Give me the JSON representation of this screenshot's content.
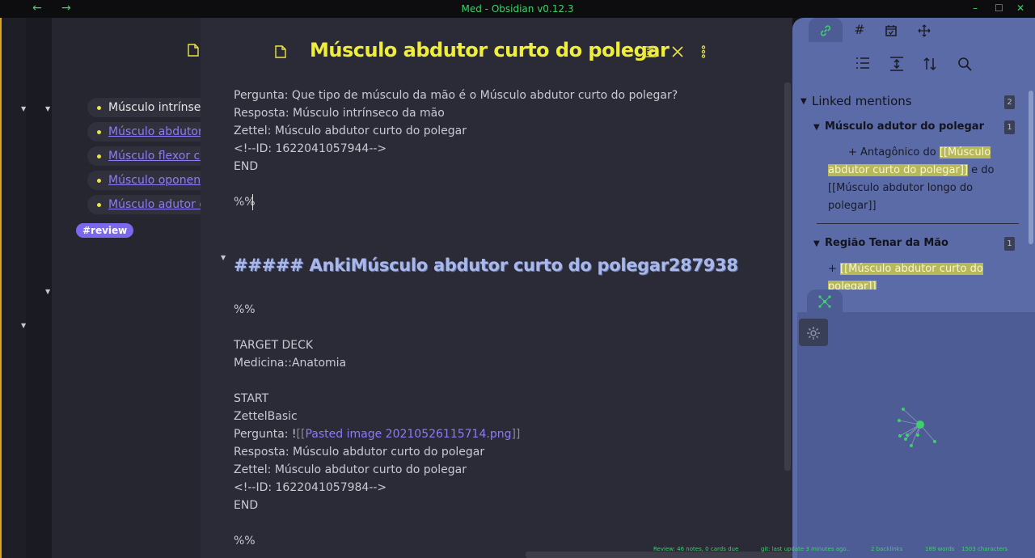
{
  "window": {
    "title": "Med - Obsidian v0.12.3",
    "back_icon": "←",
    "forward_icon": "→",
    "min_icon": "–",
    "max_icon": "☐",
    "close_icon": "✕"
  },
  "left_pane": {
    "items": [
      {
        "label": "Músculo intrínseco da mão",
        "kind": "plain"
      },
      {
        "label": "Músculo abdutor curto do polegar",
        "kind": "link"
      },
      {
        "label": "Músculo flexor curto do polegar",
        "kind": "link"
      },
      {
        "label": "Músculo oponente do polegar",
        "kind": "link"
      },
      {
        "label": "Músculo adutor do polegar",
        "kind": "link"
      }
    ],
    "tag": "#review"
  },
  "editor": {
    "title": "Músculo abdutor curto do polegar",
    "lines_top": [
      "Pergunta: Que tipo de músculo da mão é o Músculo abdutor curto do polegar?",
      "Resposta: Músculo intrínseco da mão",
      "Zettel: Músculo abdutor curto do polegar",
      "<!--ID: 1622041057944-->",
      "END",
      "",
      "%%"
    ],
    "heading": "##### AnkiMúsculo abdutor curto do polegar287938",
    "lines_bottom": [
      "%%",
      "",
      "TARGET DECK",
      "Medicina::Anatomia",
      "",
      "START",
      "ZettelBasic"
    ],
    "pergunta_prefix": "Pergunta: !",
    "pergunta_open": "[[",
    "pergunta_link": "Pasted image 20210526115714.png",
    "pergunta_close": "]]",
    "lines_tail": [
      "Resposta: Músculo abdutor curto do polegar",
      "Zettel: Músculo abdutor curto do polegar",
      "<!--ID: 1622041057984-->",
      "END",
      "",
      "%%"
    ]
  },
  "right_panel": {
    "linked_mentions_label": "Linked mentions",
    "linked_mentions_count": "2",
    "files": [
      {
        "name": "Músculo adutor do polegar",
        "count": "1",
        "prefix": "+ Antagônico do ",
        "highlight": "[[Músculo abdutor curto do polegar]]",
        "suffix": " e do [[Músculo abdutor longo do polegar]]"
      },
      {
        "name": "Região Tenar da Mão",
        "count": "1",
        "prefix": "+ ",
        "highlight": "[[Músculo abdutor curto do polegar]]",
        "suffix": ""
      }
    ]
  },
  "status": {
    "review": "Review: 46 notes, 0 cards due",
    "git": "git: last update 3 minutes ago..",
    "backlinks": "2 backlinks",
    "words": "189 words",
    "characters": "1503 characters"
  },
  "colors": {
    "accent_green": "#3dd16b",
    "title_yellow": "#f1ee3a",
    "link_purple": "#8b7cf6",
    "panel_blue": "#5a6ba8"
  }
}
